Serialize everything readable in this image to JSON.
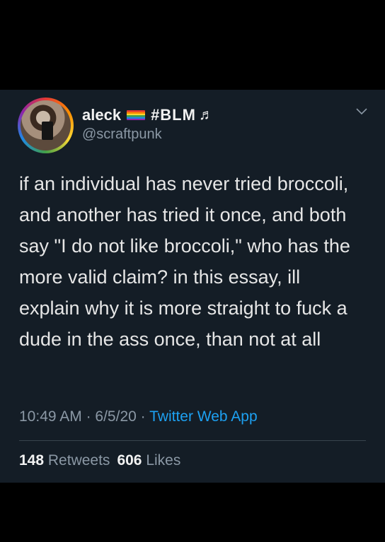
{
  "user": {
    "display_name": "aleck",
    "tag": "#BLM",
    "note_symbol": "♬",
    "handle": "@scraftpunk"
  },
  "tweet": {
    "text": "if an individual has never tried broccoli, and another has tried it once, and both say \"I do not like broccoli,\" who has the more valid claim? in this essay, ill explain why it is more straight to fuck a dude in the ass once, than not at all",
    "time": "10:49 AM",
    "date": "6/5/20",
    "separator": "·",
    "source": "Twitter Web App"
  },
  "stats": {
    "retweets_count": "148",
    "retweets_label": "Retweets",
    "likes_count": "606",
    "likes_label": "Likes"
  },
  "colors": {
    "card_background": "#141d26",
    "link_blue": "#1da1f2",
    "muted_gray": "#8b98a5"
  },
  "icons": {
    "menu": "chevron-down-icon",
    "flag": "rainbow-flag-icon"
  }
}
